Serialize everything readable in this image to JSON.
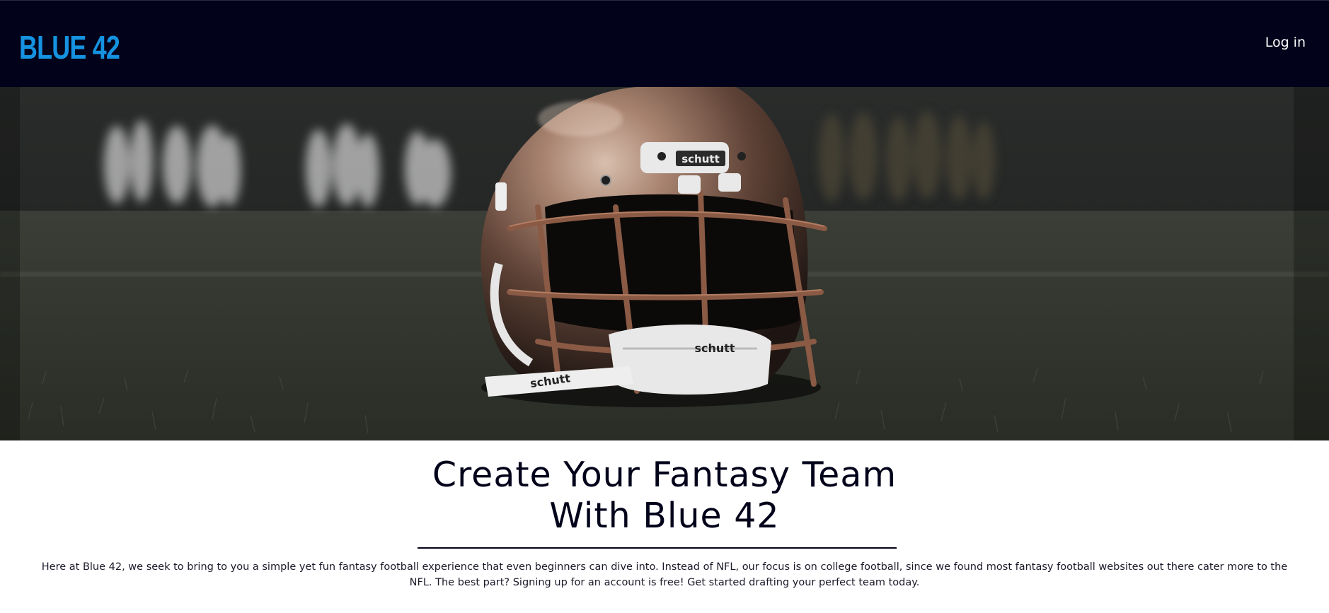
{
  "navbar": {
    "brand": "BLUE 42",
    "login_label": "Log in"
  },
  "hero": {
    "image_icon": "football-helmet-on-field-photo",
    "helmet_brand_text": "schutt"
  },
  "main": {
    "headline_line1": "Create Your Fantasy Team",
    "headline_line2": "With Blue 42",
    "description": "Here at Blue 42, we seek to bring to you a simple yet fun fantasy football experience that even beginners can dive into. Instead of NFL, our focus is on college football, since we found most fantasy football websites out there cater more to the NFL. The best part? Signing up for an account is free! Get started drafting your perfect team today."
  },
  "colors": {
    "navbar_bg": "#02021a",
    "brand_accent": "#1592e0",
    "text_dark": "#02021a"
  }
}
